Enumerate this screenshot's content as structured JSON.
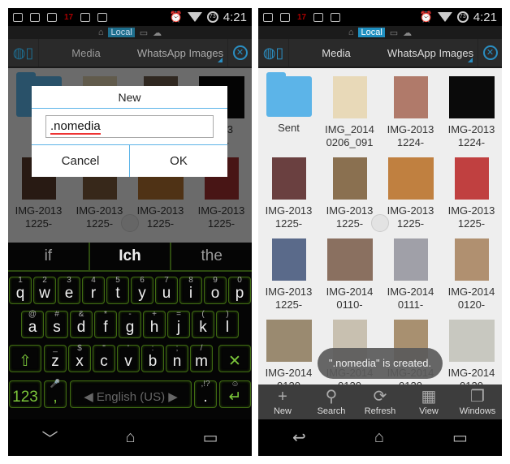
{
  "status": {
    "time": "4:21",
    "battery": "73",
    "notif_red": "17"
  },
  "location_bar": {
    "home": "⌂",
    "local": "Local",
    "pc": "▭",
    "cloud": "☁"
  },
  "breadcrumbs": [
    "Media",
    "WhatsApp Images"
  ],
  "files_left": [
    {
      "name": "S",
      "type": "folder"
    },
    {
      "name": "",
      "type": "image",
      "color": "#d8c9a8"
    },
    {
      "name": "",
      "type": "image",
      "color": "#6a5a4a"
    },
    {
      "name": "2013\n24-",
      "type": "image",
      "color": "#0a0a0a"
    },
    {
      "name": "IMG-2013\n1225-",
      "type": "image",
      "color": "#5a3a2a"
    },
    {
      "name": "IMG-2013\n1225-",
      "type": "image",
      "color": "#7a5a3a"
    },
    {
      "name": "IMG-2013\n1225-",
      "type": "image",
      "color": "#b07030"
    },
    {
      "name": "IMG-2013\n1225-",
      "type": "image",
      "color": "#a03030"
    }
  ],
  "files_right": [
    {
      "name": "Sent",
      "type": "folder"
    },
    {
      "name": "IMG_2014\n0206_091",
      "type": "image",
      "color": "#e8d9b8"
    },
    {
      "name": "IMG-2013\n1224-",
      "type": "image",
      "color": "#b07a6a"
    },
    {
      "name": "IMG-2013\n1224-",
      "type": "image",
      "color": "#0a0a0a"
    },
    {
      "name": "IMG-2013\n1225-",
      "type": "image",
      "color": "#6a4040"
    },
    {
      "name": "IMG-2013\n1225-",
      "type": "image",
      "color": "#8a7050"
    },
    {
      "name": "IMG-2013\n1225-",
      "type": "image",
      "color": "#c08040"
    },
    {
      "name": "IMG-2013\n1225-",
      "type": "image",
      "color": "#c04040"
    },
    {
      "name": "IMG-2013\n1225-",
      "type": "image",
      "color": "#5a6a8a"
    },
    {
      "name": "IMG-2014\n0110-",
      "type": "image",
      "color": "#8a7060"
    },
    {
      "name": "IMG-2014\n0111-",
      "type": "image",
      "color": "#a0a0a8"
    },
    {
      "name": "IMG-2014\n0120-",
      "type": "image",
      "color": "#b09070"
    },
    {
      "name": "IMG-2014\n0120",
      "type": "image",
      "color": "#9a8a70"
    },
    {
      "name": "IMG-2014\n0120",
      "type": "image",
      "color": "#c8c0b0"
    },
    {
      "name": "IMG-2014\n0120",
      "type": "image",
      "color": "#a89070"
    },
    {
      "name": "IMG-2014\n0120",
      "type": "image",
      "color": "#c8c8c0"
    }
  ],
  "dialog": {
    "title": "New",
    "input_value": ".nomedia",
    "cancel": "Cancel",
    "ok": "OK"
  },
  "keyboard": {
    "suggestions": [
      "if",
      "Ich",
      "the"
    ],
    "row1": [
      [
        "q",
        "1"
      ],
      [
        "w",
        "2"
      ],
      [
        "e",
        "3"
      ],
      [
        "r",
        "4"
      ],
      [
        "t",
        "5"
      ],
      [
        "y",
        "6"
      ],
      [
        "u",
        "7"
      ],
      [
        "i",
        "8"
      ],
      [
        "o",
        "9"
      ],
      [
        "p",
        "0"
      ]
    ],
    "row2": [
      [
        "a",
        "@"
      ],
      [
        "s",
        "#"
      ],
      [
        "d",
        "&"
      ],
      [
        "f",
        "*"
      ],
      [
        "g",
        "-"
      ],
      [
        "h",
        "+"
      ],
      [
        "j",
        "="
      ],
      [
        "k",
        "("
      ],
      [
        "l",
        ")"
      ]
    ],
    "row3": [
      [
        "z",
        "_"
      ],
      [
        "x",
        "$"
      ],
      [
        "c",
        "\""
      ],
      [
        "v",
        "'"
      ],
      [
        "b",
        ":"
      ],
      [
        "n",
        ";"
      ],
      [
        "m",
        "/"
      ]
    ],
    "symbols_key": "123",
    "comma": ",",
    "space_label": "English (US)",
    "period": ".",
    "period_sup": ",!?"
  },
  "toolbar": [
    {
      "label": "New",
      "icon": "+"
    },
    {
      "label": "Search",
      "icon": "⚲"
    },
    {
      "label": "Refresh",
      "icon": "⟳"
    },
    {
      "label": "View",
      "icon": "▦"
    },
    {
      "label": "Windows",
      "icon": "❐"
    }
  ],
  "toast": "\".nomedia\" is created."
}
